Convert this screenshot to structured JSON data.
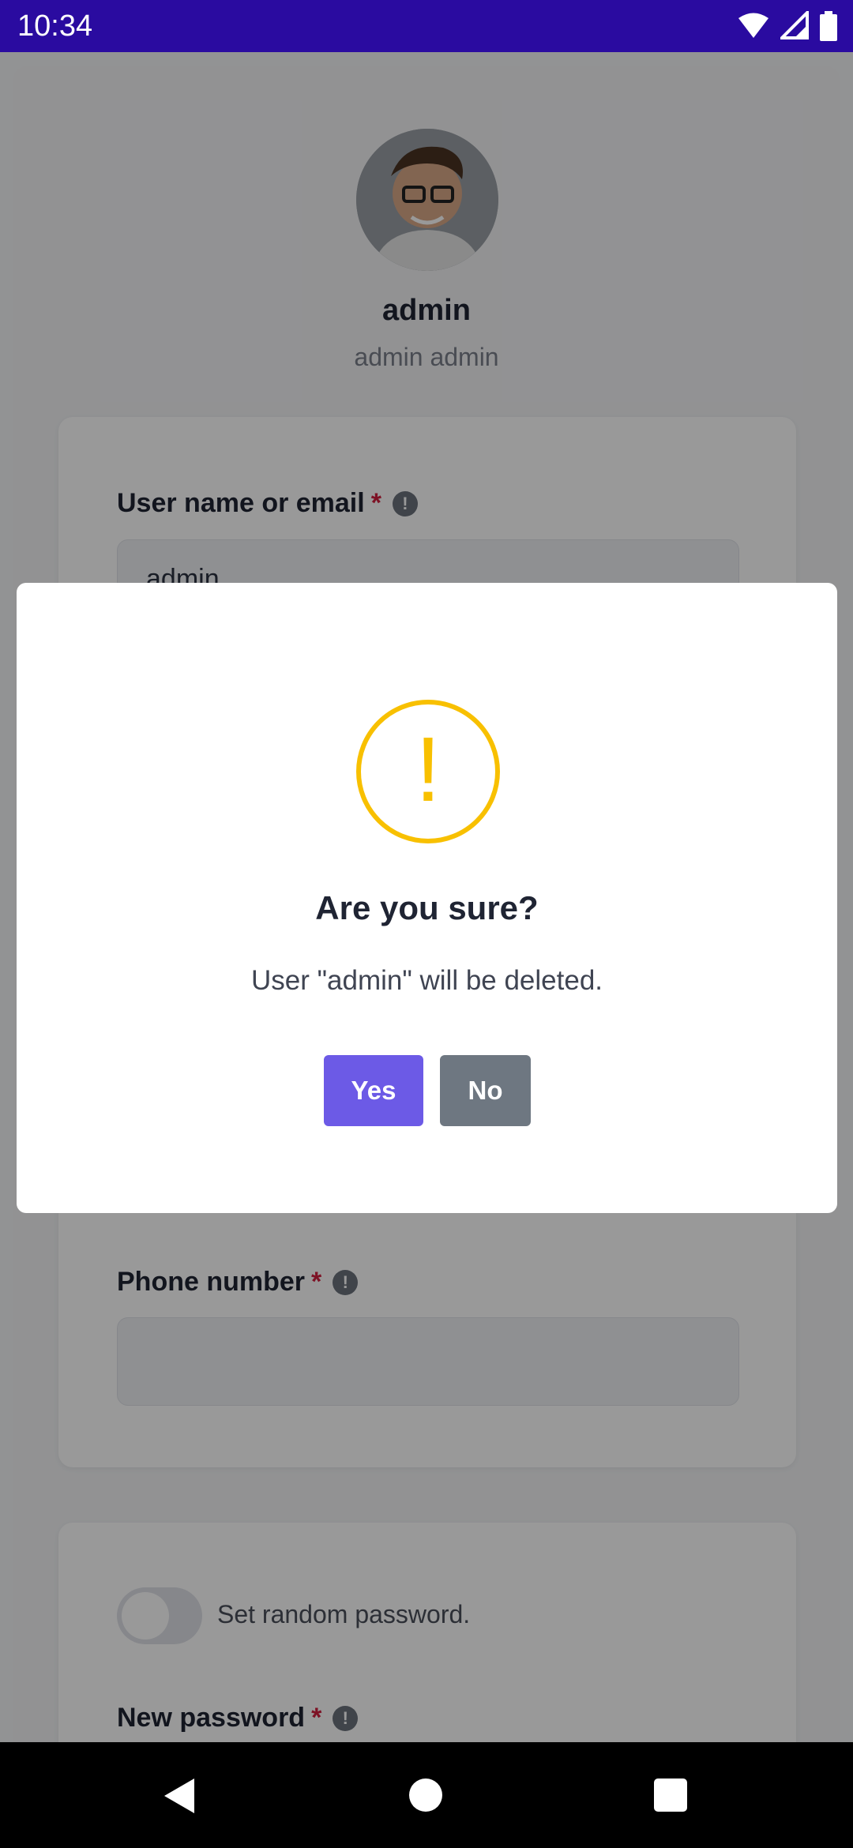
{
  "status_bar": {
    "time": "10:34"
  },
  "profile": {
    "name": "admin",
    "full_name": "admin admin"
  },
  "form": {
    "username_label": "User name or email",
    "username_value": "admin",
    "phone_label": "Phone number",
    "required_marker": "*",
    "random_password_label": "Set random password.",
    "new_password_label": "New password"
  },
  "dialog": {
    "title": "Are you sure?",
    "message": "User \"admin\" will be deleted.",
    "yes_label": "Yes",
    "no_label": "No",
    "icon": "warning-exclamation-icon",
    "icon_glyph": "!"
  },
  "colors": {
    "status_bar": "#2a0ba0",
    "warning": "#f8c000",
    "primary_button": "#6c5ae6",
    "secondary_button": "#6e7781",
    "required": "#d11f3e"
  }
}
